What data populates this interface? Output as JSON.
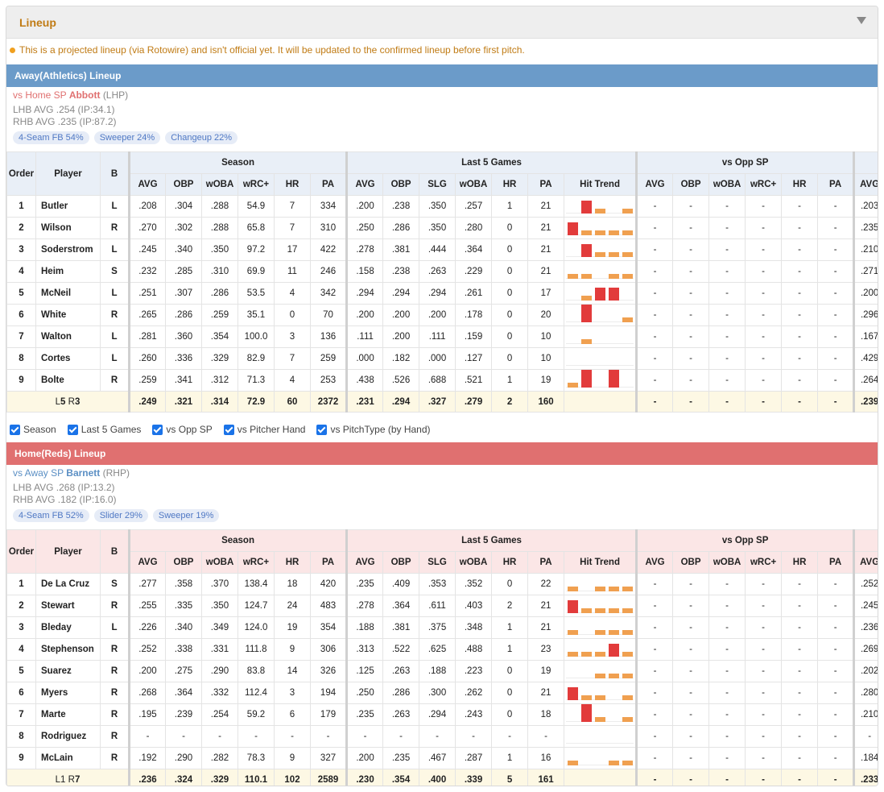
{
  "panel": {
    "title": "Lineup"
  },
  "notice": "This is a projected lineup (via Rotowire) and isn't official yet. It will be updated to the confirmed lineup before first pitch.",
  "colors": {
    "away": "#6b9bc9",
    "home": "#e07070",
    "up": "#e23b3b",
    "down": "#f0a050"
  },
  "headers": {
    "groups": [
      "Season",
      "Last 5 Games",
      "vs Opp SP"
    ],
    "order": "Order",
    "player": "Player",
    "bats": "B",
    "season": [
      "AVG",
      "OBP",
      "wOBA",
      "wRC+",
      "HR",
      "PA"
    ],
    "last5": [
      "AVG",
      "OBP",
      "SLG",
      "wOBA",
      "HR",
      "PA",
      "Hit Trend"
    ],
    "opp": [
      "AVG",
      "OBP",
      "wOBA",
      "wRC+",
      "HR",
      "PA"
    ],
    "extra": "AVG"
  },
  "filters": [
    "Season",
    "Last 5 Games",
    "vs Opp SP",
    "vs Pitcher Hand",
    "vs PitchType (by Hand)"
  ],
  "away": {
    "title": "Away(Athletics) Lineup",
    "sp_prefix": "vs Home SP",
    "sp_name": "Abbott",
    "sp_hand": "(LHP)",
    "lhb": "LHB AVG .254 (IP:34.1)",
    "rhb": "RHB AVG .235 (IP:87.2)",
    "pitches": [
      "4-Seam FB 54%",
      "Sweeper 24%",
      "Changeup 22%"
    ],
    "rows": [
      {
        "o": "1",
        "name": "Butler",
        "b": "L",
        "s": [
          ".208",
          ".304",
          ".288",
          "54.9",
          "7",
          "334"
        ],
        "l": [
          ".200",
          ".238",
          ".350",
          ".257",
          "1",
          "21"
        ],
        "t": [
          0,
          2,
          1,
          0,
          1
        ],
        "opp": [
          "-",
          "-",
          "-",
          "-",
          "-",
          "-"
        ],
        "x": ".203"
      },
      {
        "o": "2",
        "name": "Wilson",
        "b": "R",
        "s": [
          ".270",
          ".302",
          ".288",
          "65.8",
          "7",
          "310"
        ],
        "l": [
          ".250",
          ".286",
          ".350",
          ".280",
          "0",
          "21"
        ],
        "t": [
          2,
          1,
          1,
          1,
          1
        ],
        "opp": [
          "-",
          "-",
          "-",
          "-",
          "-",
          "-"
        ],
        "x": ".235"
      },
      {
        "o": "3",
        "name": "Soderstrom",
        "b": "L",
        "s": [
          ".245",
          ".340",
          ".350",
          "97.2",
          "17",
          "422"
        ],
        "l": [
          ".278",
          ".381",
          ".444",
          ".364",
          "0",
          "21"
        ],
        "t": [
          0,
          2,
          1,
          1,
          1
        ],
        "opp": [
          "-",
          "-",
          "-",
          "-",
          "-",
          "-"
        ],
        "x": ".210"
      },
      {
        "o": "4",
        "name": "Heim",
        "b": "S",
        "s": [
          ".232",
          ".285",
          ".310",
          "69.9",
          "11",
          "246"
        ],
        "l": [
          ".158",
          ".238",
          ".263",
          ".229",
          "0",
          "21"
        ],
        "t": [
          1,
          1,
          0,
          1,
          1
        ],
        "opp": [
          "-",
          "-",
          "-",
          "-",
          "-",
          "-"
        ],
        "x": ".271"
      },
      {
        "o": "5",
        "name": "McNeil",
        "b": "L",
        "s": [
          ".251",
          ".307",
          ".286",
          "53.5",
          "4",
          "342"
        ],
        "l": [
          ".294",
          ".294",
          ".294",
          ".261",
          "0",
          "17"
        ],
        "t": [
          0,
          1,
          2,
          2,
          0
        ],
        "opp": [
          "-",
          "-",
          "-",
          "-",
          "-",
          "-"
        ],
        "x": ".200"
      },
      {
        "o": "6",
        "name": "White",
        "b": "R",
        "s": [
          ".265",
          ".286",
          ".259",
          "35.1",
          "0",
          "70"
        ],
        "l": [
          ".200",
          ".200",
          ".200",
          ".178",
          "0",
          "20"
        ],
        "t": [
          0,
          3,
          0,
          0,
          1
        ],
        "opp": [
          "-",
          "-",
          "-",
          "-",
          "-",
          "-"
        ],
        "x": ".296"
      },
      {
        "o": "7",
        "name": "Walton",
        "b": "L",
        "s": [
          ".281",
          ".360",
          ".354",
          "100.0",
          "3",
          "136"
        ],
        "l": [
          ".111",
          ".200",
          ".111",
          ".159",
          "0",
          "10"
        ],
        "t": [
          0,
          1,
          0,
          0,
          0
        ],
        "opp": [
          "-",
          "-",
          "-",
          "-",
          "-",
          "-"
        ],
        "x": ".167"
      },
      {
        "o": "8",
        "name": "Cortes",
        "b": "L",
        "s": [
          ".260",
          ".336",
          ".329",
          "82.9",
          "7",
          "259"
        ],
        "l": [
          ".000",
          ".182",
          ".000",
          ".127",
          "0",
          "10"
        ],
        "t": [
          0,
          0,
          0,
          0,
          0
        ],
        "opp": [
          "-",
          "-",
          "-",
          "-",
          "-",
          "-"
        ],
        "x": ".429"
      },
      {
        "o": "9",
        "name": "Bolte",
        "b": "R",
        "s": [
          ".259",
          ".341",
          ".312",
          "71.3",
          "4",
          "253"
        ],
        "l": [
          ".438",
          ".526",
          ".688",
          ".521",
          "1",
          "19"
        ],
        "t": [
          1,
          3,
          0,
          3,
          0
        ],
        "opp": [
          "-",
          "-",
          "-",
          "-",
          "-",
          "-"
        ],
        "x": ".264"
      }
    ],
    "sum": {
      "pre": "L",
      "n1": "5",
      "mid": " R",
      "n2": "3",
      "s": [
        ".249",
        ".321",
        ".314",
        "72.9",
        "60",
        "2372"
      ],
      "l": [
        ".231",
        ".294",
        ".327",
        ".279",
        "2",
        "160"
      ],
      "opp": [
        "-",
        "-",
        "-",
        "-",
        "-",
        "-"
      ],
      "x": ".239"
    }
  },
  "home": {
    "title": "Home(Reds) Lineup",
    "sp_prefix": "vs Away SP",
    "sp_name": "Barnett",
    "sp_hand": "(RHP)",
    "lhb": "LHB AVG .268 (IP:13.2)",
    "rhb": "RHB AVG .182 (IP:16.0)",
    "pitches": [
      "4-Seam FB 52%",
      "Slider 29%",
      "Sweeper 19%"
    ],
    "rows": [
      {
        "o": "1",
        "name": "De La Cruz",
        "b": "S",
        "s": [
          ".277",
          ".358",
          ".370",
          "138.4",
          "18",
          "420"
        ],
        "l": [
          ".235",
          ".409",
          ".353",
          ".352",
          "0",
          "22"
        ],
        "t": [
          1,
          0,
          1,
          1,
          1
        ],
        "opp": [
          "-",
          "-",
          "-",
          "-",
          "-",
          "-"
        ],
        "x": ".252"
      },
      {
        "o": "2",
        "name": "Stewart",
        "b": "R",
        "s": [
          ".255",
          ".335",
          ".350",
          "124.7",
          "24",
          "483"
        ],
        "l": [
          ".278",
          ".364",
          ".611",
          ".403",
          "2",
          "21"
        ],
        "t": [
          2,
          1,
          1,
          1,
          1
        ],
        "opp": [
          "-",
          "-",
          "-",
          "-",
          "-",
          "-"
        ],
        "x": ".245"
      },
      {
        "o": "3",
        "name": "Bleday",
        "b": "L",
        "s": [
          ".226",
          ".340",
          ".349",
          "124.0",
          "19",
          "354"
        ],
        "l": [
          ".188",
          ".381",
          ".375",
          ".348",
          "1",
          "21"
        ],
        "t": [
          1,
          0,
          1,
          1,
          1
        ],
        "opp": [
          "-",
          "-",
          "-",
          "-",
          "-",
          "-"
        ],
        "x": ".236"
      },
      {
        "o": "4",
        "name": "Stephenson",
        "b": "R",
        "s": [
          ".252",
          ".338",
          ".331",
          "111.8",
          "9",
          "306"
        ],
        "l": [
          ".313",
          ".522",
          ".625",
          ".488",
          "1",
          "23"
        ],
        "t": [
          1,
          1,
          1,
          2,
          1
        ],
        "opp": [
          "-",
          "-",
          "-",
          "-",
          "-",
          "-"
        ],
        "x": ".269"
      },
      {
        "o": "5",
        "name": "Suarez",
        "b": "R",
        "s": [
          ".200",
          ".275",
          ".290",
          "83.8",
          "14",
          "326"
        ],
        "l": [
          ".125",
          ".263",
          ".188",
          ".223",
          "0",
          "19"
        ],
        "t": [
          0,
          0,
          1,
          1,
          1
        ],
        "opp": [
          "-",
          "-",
          "-",
          "-",
          "-",
          "-"
        ],
        "x": ".202"
      },
      {
        "o": "6",
        "name": "Myers",
        "b": "R",
        "s": [
          ".268",
          ".364",
          ".332",
          "112.4",
          "3",
          "194"
        ],
        "l": [
          ".250",
          ".286",
          ".300",
          ".262",
          "0",
          "21"
        ],
        "t": [
          2,
          1,
          1,
          0,
          1
        ],
        "opp": [
          "-",
          "-",
          "-",
          "-",
          "-",
          "-"
        ],
        "x": ".280"
      },
      {
        "o": "7",
        "name": "Marte",
        "b": "R",
        "s": [
          ".195",
          ".239",
          ".254",
          "59.2",
          "6",
          "179"
        ],
        "l": [
          ".235",
          ".263",
          ".294",
          ".243",
          "0",
          "18"
        ],
        "t": [
          0,
          3,
          1,
          0,
          1
        ],
        "opp": [
          "-",
          "-",
          "-",
          "-",
          "-",
          "-"
        ],
        "x": ".210"
      },
      {
        "o": "8",
        "name": "Rodriguez",
        "b": "R",
        "s": [
          "-",
          "-",
          "-",
          "-",
          "-",
          "-"
        ],
        "l": [
          "-",
          "-",
          "-",
          "-",
          "-",
          "-"
        ],
        "t": [
          0,
          0,
          0,
          0,
          0
        ],
        "opp": [
          "-",
          "-",
          "-",
          "-",
          "-",
          "-"
        ],
        "x": "-"
      },
      {
        "o": "9",
        "name": "McLain",
        "b": "R",
        "s": [
          ".192",
          ".290",
          ".282",
          "78.3",
          "9",
          "327"
        ],
        "l": [
          ".200",
          ".235",
          ".467",
          ".287",
          "1",
          "16"
        ],
        "t": [
          1,
          0,
          0,
          1,
          1
        ],
        "opp": [
          "-",
          "-",
          "-",
          "-",
          "-",
          "-"
        ],
        "x": ".184"
      }
    ],
    "sum": {
      "pre": "L1",
      "n1": "",
      "mid": " R",
      "n2": "7",
      "s": [
        ".236",
        ".324",
        ".329",
        "110.1",
        "102",
        "2589"
      ],
      "l": [
        ".230",
        ".354",
        ".400",
        ".339",
        "5",
        "161"
      ],
      "opp": [
        "-",
        "-",
        "-",
        "-",
        "-",
        "-"
      ],
      "x": ".233"
    }
  },
  "sum_colors": {
    "away": {
      "s": [
        "g",
        "r",
        "r",
        "r",
        "r",
        "k"
      ],
      "l": [
        "g",
        "r",
        "k",
        "r",
        "r",
        "k"
      ],
      "x": "g"
    },
    "home": {
      "s": [
        "r",
        "g",
        "g",
        "g",
        "g",
        "k"
      ],
      "l": [
        "r",
        "g",
        "k",
        "g",
        "g",
        "k"
      ],
      "x": "r"
    }
  }
}
